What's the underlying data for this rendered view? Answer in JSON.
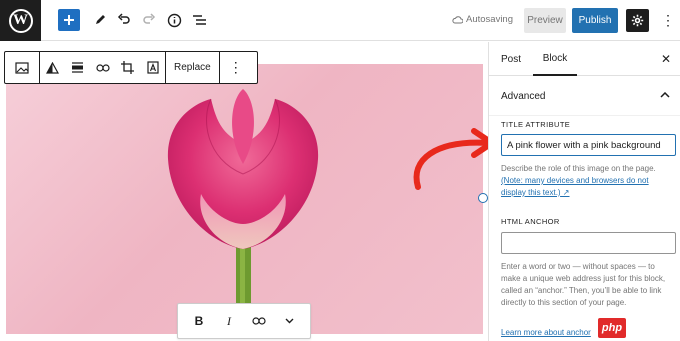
{
  "topbar": {
    "autosave_label": "Autosaving",
    "preview_label": "Preview",
    "publish_label": "Publish",
    "colors": {
      "accent": "#2271b1",
      "add_button": "#1f6fc1",
      "logo_bg": "#1e1e1e"
    }
  },
  "block_toolbar": {
    "replace_label": "Replace",
    "icons": [
      "image-icon",
      "duotone-icon",
      "align-icon",
      "link-icon",
      "crop-icon",
      "text-overlay-icon",
      "more-options-icon"
    ]
  },
  "format_toolbar": {
    "bold_label": "B",
    "italic_label": "I",
    "icons": [
      "bold-icon",
      "italic-icon",
      "link-icon",
      "chevron-down-icon"
    ]
  },
  "sidebar": {
    "tabs": [
      {
        "label": "Post"
      },
      {
        "label": "Block",
        "active": true
      }
    ],
    "panel_title": "Advanced",
    "title_attribute": {
      "label": "TITLE ATTRIBUTE",
      "value": "A pink flower with a pink background",
      "help": "Describe the role of this image on the page.",
      "note_link": "(Note: many devices and browsers do not display this text.)"
    },
    "html_anchor": {
      "label": "HTML ANCHOR",
      "value": "",
      "help": "Enter a word or two — without spaces — to make a unique web address just for this block, called an “anchor.” Then, you’ll be able to link directly to this section of your page.",
      "learn_more": "Learn more about anchor"
    }
  },
  "watermark": "php",
  "arrow_color": "#e8291c"
}
